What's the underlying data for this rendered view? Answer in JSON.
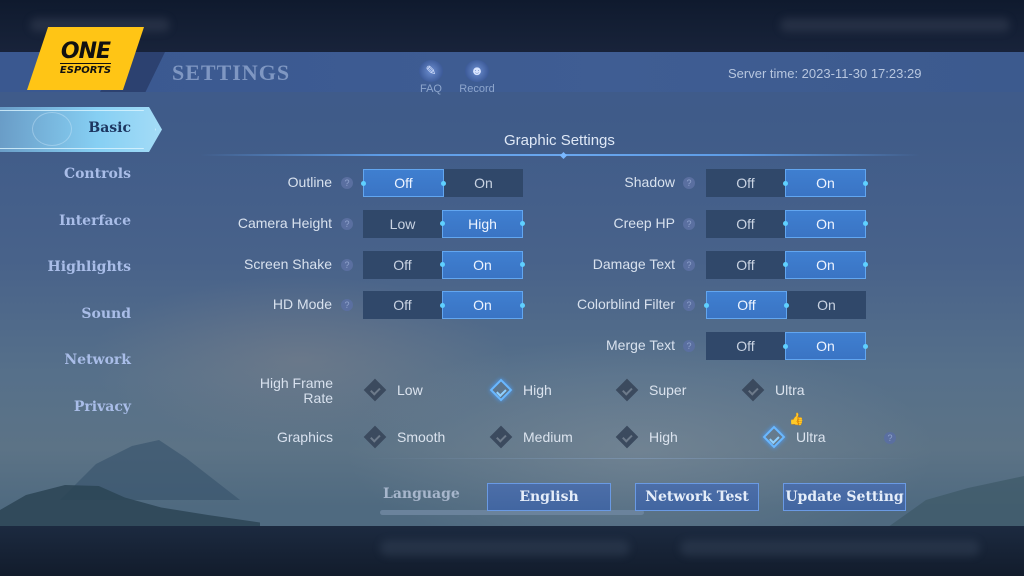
{
  "header": {
    "logo_top": "ONE",
    "logo_bottom": "ESPORTS",
    "title": "SETTINGS",
    "icons": [
      {
        "name": "faq",
        "label": "FAQ",
        "glyph": "✎"
      },
      {
        "name": "record",
        "label": "Record",
        "glyph": "☻"
      }
    ],
    "server_time": "Server time: 2023-11-30 17:23:29"
  },
  "sidebar": {
    "items": [
      {
        "label": "Basic",
        "active": true
      },
      {
        "label": "Controls",
        "active": false
      },
      {
        "label": "Interface",
        "active": false
      },
      {
        "label": "Highlights",
        "active": false
      },
      {
        "label": "Sound",
        "active": false
      },
      {
        "label": "Network",
        "active": false
      },
      {
        "label": "Privacy",
        "active": false
      }
    ]
  },
  "graphic_settings": {
    "title": "Graphic Settings",
    "help_glyph": "?",
    "left": [
      {
        "label": "Outline",
        "options": [
          "Off",
          "On"
        ],
        "selected": "Off"
      },
      {
        "label": "Camera Height",
        "options": [
          "Low",
          "High"
        ],
        "selected": "High"
      },
      {
        "label": "Screen Shake",
        "options": [
          "Off",
          "On"
        ],
        "selected": "On"
      },
      {
        "label": "HD Mode",
        "options": [
          "Off",
          "On"
        ],
        "selected": "On"
      }
    ],
    "right": [
      {
        "label": "Shadow",
        "options": [
          "Off",
          "On"
        ],
        "selected": "On"
      },
      {
        "label": "Creep HP",
        "options": [
          "Off",
          "On"
        ],
        "selected": "On"
      },
      {
        "label": "Damage Text",
        "options": [
          "Off",
          "On"
        ],
        "selected": "On"
      },
      {
        "label": "Colorblind Filter",
        "options": [
          "Off",
          "On"
        ],
        "selected": "Off"
      },
      {
        "label": "Merge Text",
        "options": [
          "Off",
          "On"
        ],
        "selected": "On"
      }
    ],
    "high_frame_rate": {
      "label_line1": "High Frame",
      "label_line2": "Rate",
      "options": [
        "Low",
        "High",
        "Super",
        "Ultra"
      ],
      "selected": "High"
    },
    "graphics": {
      "label": "Graphics",
      "options": [
        "Smooth",
        "Medium",
        "High",
        "Ultra"
      ],
      "selected": "Ultra",
      "recommended": "Ultra",
      "recommended_glyph": "👍"
    }
  },
  "footer": {
    "language_label": "Language",
    "language_value": "English",
    "network_test": "Network Test",
    "update_setting": "Update Setting"
  }
}
